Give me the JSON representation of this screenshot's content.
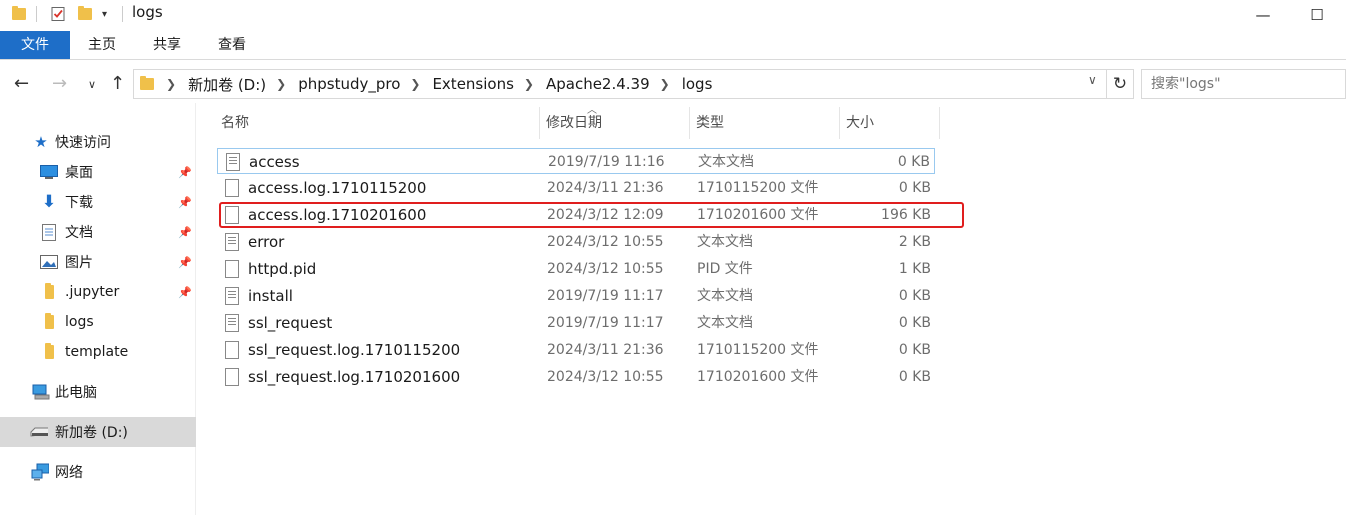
{
  "window": {
    "title": "logs",
    "minimize_glyph": "—",
    "maximize_glyph": "☐"
  },
  "ribbon": {
    "tabs": [
      {
        "label": "文件",
        "active": true
      },
      {
        "label": "主页"
      },
      {
        "label": "共享"
      },
      {
        "label": "查看"
      }
    ]
  },
  "address": {
    "crumbs": [
      "新加卷 (D:)",
      "phpstudy_pro",
      "Extensions",
      "Apache2.4.39",
      "logs"
    ],
    "search_placeholder": "搜索\"logs\""
  },
  "sidebar": {
    "quick_access": "快速访问",
    "pinned": [
      "桌面",
      "下载",
      "文档",
      "图片",
      ".jupyter"
    ],
    "folders": [
      "logs",
      "template"
    ],
    "this_pc": "此电脑",
    "drive": "新加卷 (D:)",
    "network": "网络"
  },
  "columns": {
    "name": "名称",
    "date": "修改日期",
    "type": "类型",
    "size": "大小"
  },
  "files": [
    {
      "name": "access",
      "date": "2019/7/19 11:16",
      "type": "文本文档",
      "size": "0 KB",
      "icon": "text-file-icon"
    },
    {
      "name": "access.log.1710115200",
      "date": "2024/3/11 21:36",
      "type": "1710115200 文件",
      "size": "0 KB",
      "icon": "blank-file-icon"
    },
    {
      "name": "access.log.1710201600",
      "date": "2024/3/12 12:09",
      "type": "1710201600 文件",
      "size": "196 KB",
      "icon": "blank-file-icon"
    },
    {
      "name": "error",
      "date": "2024/3/12 10:55",
      "type": "文本文档",
      "size": "2 KB",
      "icon": "text-file-icon"
    },
    {
      "name": "httpd.pid",
      "date": "2024/3/12 10:55",
      "type": "PID 文件",
      "size": "1 KB",
      "icon": "blank-file-icon"
    },
    {
      "name": "install",
      "date": "2019/7/19 11:17",
      "type": "文本文档",
      "size": "0 KB",
      "icon": "text-file-icon"
    },
    {
      "name": "ssl_request",
      "date": "2019/7/19 11:17",
      "type": "文本文档",
      "size": "0 KB",
      "icon": "text-file-icon"
    },
    {
      "name": "ssl_request.log.1710115200",
      "date": "2024/3/11 21:36",
      "type": "1710115200 文件",
      "size": "0 KB",
      "icon": "blank-file-icon"
    },
    {
      "name": "ssl_request.log.1710201600",
      "date": "2024/3/12 10:55",
      "type": "1710201600 文件",
      "size": "0 KB",
      "icon": "blank-file-icon"
    }
  ],
  "colors": {
    "file_tab_bg": "#1e6ec8",
    "highlight_border": "#e01e1e",
    "selected_nav_bg": "#d9d9d9"
  }
}
